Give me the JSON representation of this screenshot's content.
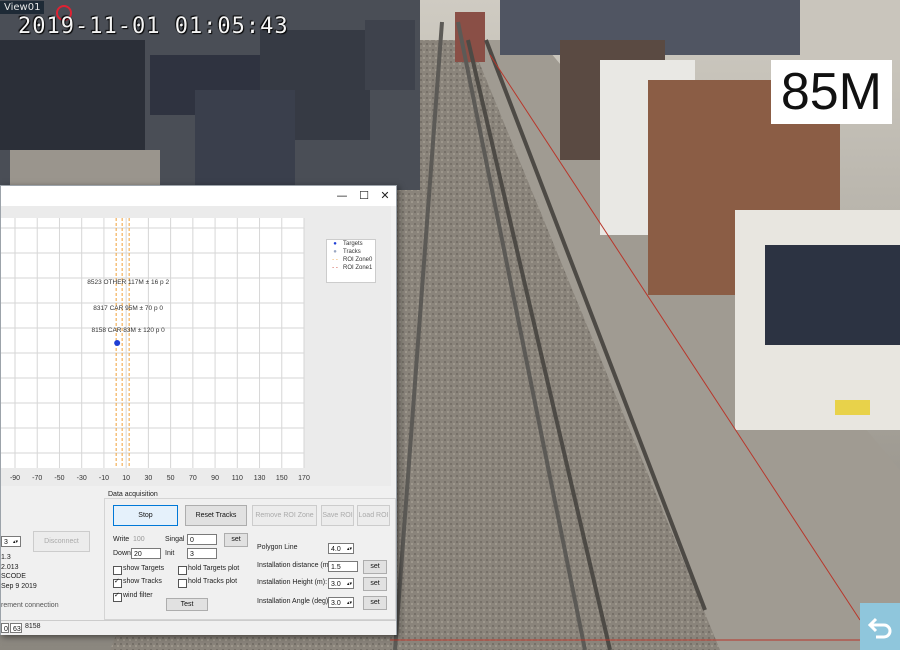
{
  "camera": {
    "view_label": "View01",
    "timestamp": "2019-11-01 01:05:43",
    "distance_overlay": "85M"
  },
  "window": {
    "controls": {
      "minimize": "—",
      "maximize": "☐",
      "close": "✕"
    }
  },
  "chart_data": {
    "type": "scatter",
    "x_ticks": [
      "-90",
      "-70",
      "-50",
      "-30",
      "-10",
      "10",
      "30",
      "50",
      "70",
      "90",
      "110",
      "130",
      "150",
      "170"
    ],
    "xlim": [
      -90,
      170
    ],
    "legend": [
      {
        "label": "Targets",
        "marker": "dot",
        "color": "#1f3fd6"
      },
      {
        "label": "Tracks",
        "marker": "dot",
        "color": "#9aa7c2"
      },
      {
        "label": "ROI Zone0",
        "marker": "dash",
        "color": "#f0a23a"
      },
      {
        "label": "ROI Zone1",
        "marker": "dash",
        "color": "#c53a2a"
      }
    ],
    "annotations": [
      "8523 OTHER 117M ± 16 p 2",
      "8317 CAR 95M ± 70 p 0",
      "8158 CAR 83M ± 120 p 0"
    ],
    "target_point": {
      "x": 10
    }
  },
  "data_acquisition": {
    "title": "Data acquisition",
    "stop_label": "Stop",
    "reset_tracks_label": "Reset Tracks",
    "remove_roi_label": "Remove ROI Zone",
    "save_roi_label": "Save ROI",
    "load_roi_label": "Load ROI",
    "write_label": "Write",
    "write_value": "100",
    "singal_label": "Singal",
    "singal_value": "0",
    "set_label": "set",
    "down_label": "Down",
    "down_value": "20",
    "init_label": "Init",
    "init_value": "3",
    "show_targets": "show Targets",
    "show_tracks": "show Tracks",
    "wind_filter": "wind filter",
    "hold_targets_plot": "hold Targets plot",
    "hold_tracks_plot": "hold Tracks plot",
    "test_label": "Test",
    "polygon_line_label": "Polygon Line",
    "polygon_line_value": "4.0",
    "install_distance_label": "Installation distance (m):",
    "install_distance_value": "1.5",
    "install_height_label": "Installation Height (m):",
    "install_height_value": "3.0",
    "install_angle_label": "Installation Angle (deg):",
    "install_angle_value": "3.0"
  },
  "left_panel": {
    "disconnect_label": "Disconnect",
    "combo_value": "3",
    "line1": "1.3",
    "line2": "2.013",
    "line3": "SCODE",
    "line4": "Sep  9 2019",
    "connection_text": "rement connection"
  },
  "statusbar": {
    "field_a": "0",
    "field_b": "63",
    "field_c": "8158"
  }
}
